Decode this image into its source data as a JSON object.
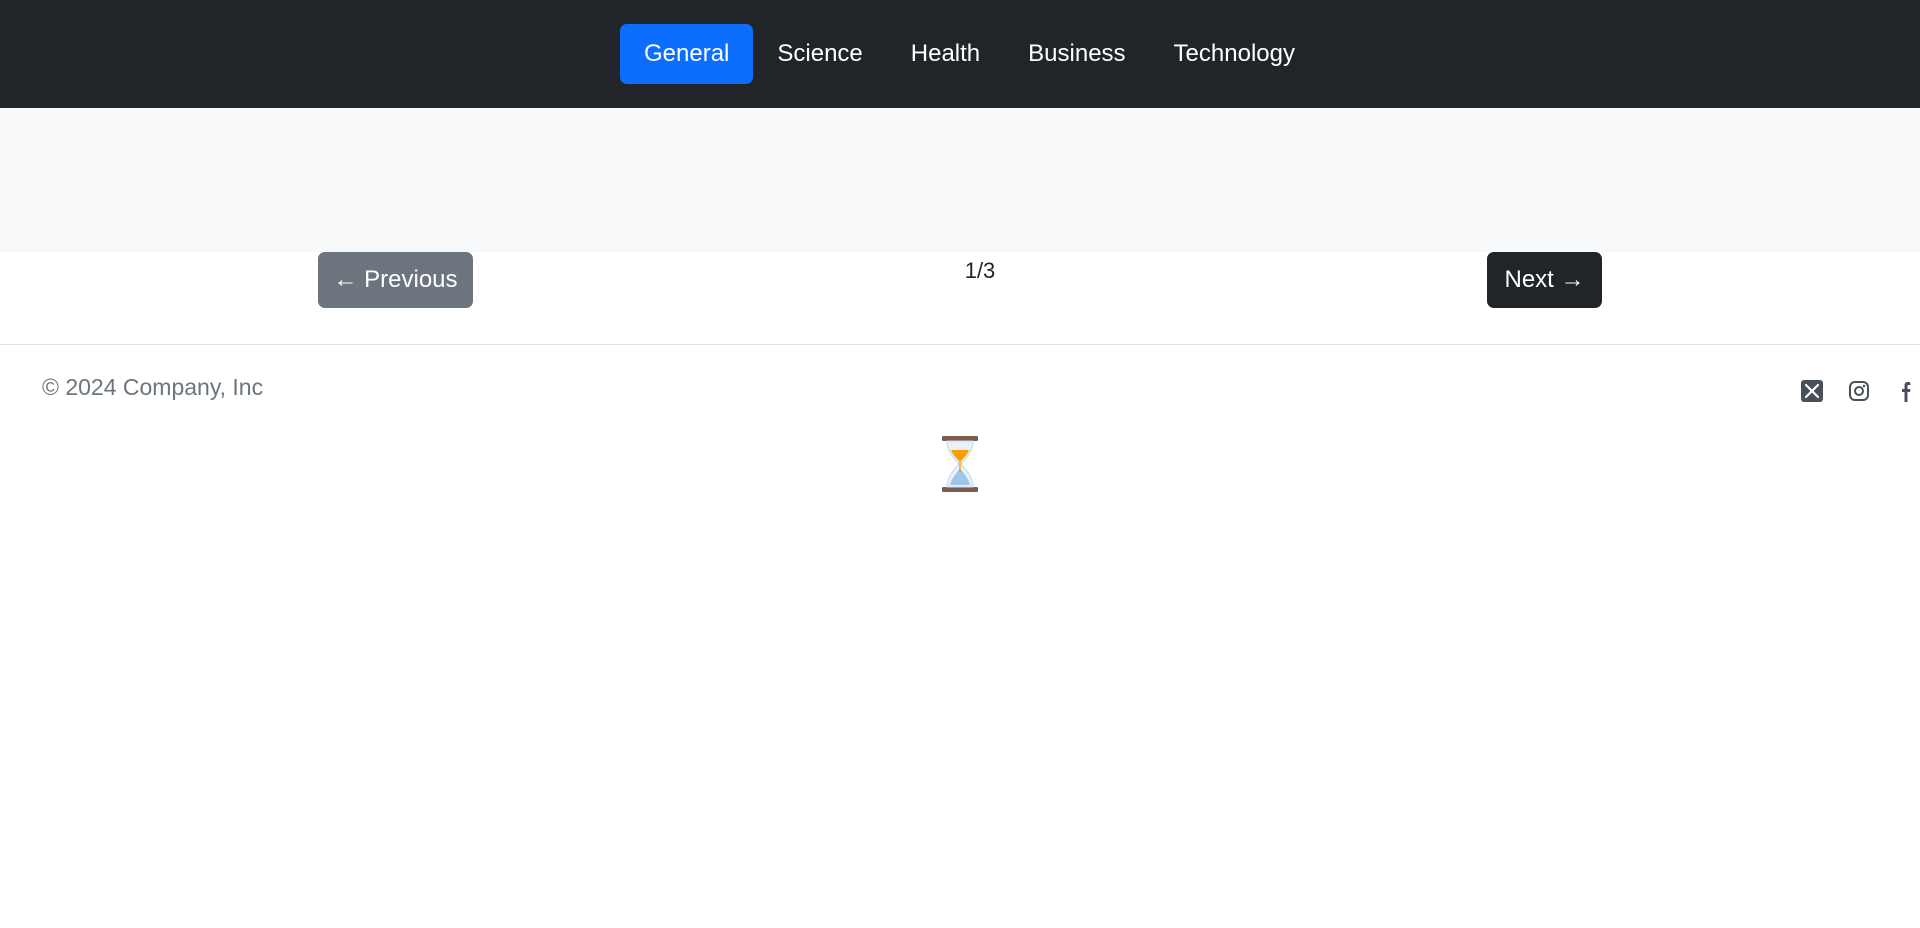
{
  "nav": {
    "items": [
      {
        "label": "General",
        "active": true
      },
      {
        "label": "Science",
        "active": false
      },
      {
        "label": "Health",
        "active": false
      },
      {
        "label": "Business",
        "active": false
      },
      {
        "label": "Technology",
        "active": false
      }
    ]
  },
  "pagination": {
    "prev_label": "← Previous",
    "next_label": "Next →",
    "indicator": "1/3"
  },
  "footer": {
    "copyright": "© 2024 Company, Inc",
    "social_icons": [
      "x-twitter-icon",
      "instagram-icon",
      "facebook-icon"
    ]
  },
  "loading": {
    "icon": "hourglass-icon"
  },
  "colors": {
    "navbar_bg": "#212529",
    "active_pill": "#0d6efd",
    "banner_bg": "#f8f9fa",
    "prev_button": "#6c757d",
    "next_button": "#212529",
    "muted_text": "#6c757d"
  }
}
